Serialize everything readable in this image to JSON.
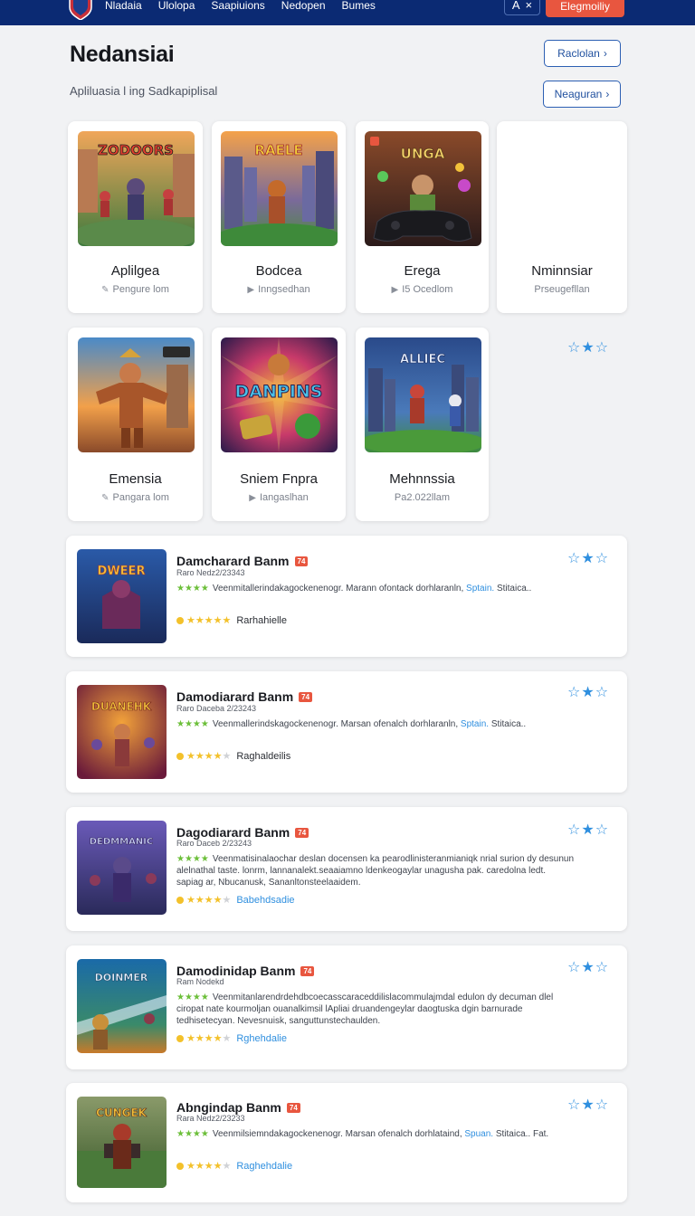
{
  "nav": {
    "links": [
      "Nladaia",
      "Ulolopa",
      "Saapiuions",
      "Nedopen",
      "Bumes"
    ],
    "lang_label": "A",
    "lang_close": "×",
    "cta_label": "Elegmoiliy"
  },
  "header": {
    "title": "Nedansiai",
    "subtitle": "Apliluasia l ing Sadkapiplisal",
    "btn_primary": "Raclolan",
    "btn_primary_icon": "›",
    "btn_secondary": "Neaguran",
    "btn_secondary_icon": "›"
  },
  "colors": {
    "nav_bg": "#0b2a73",
    "accent_red": "#e8563f",
    "accent_blue": "#2f8fdf",
    "star_yellow": "#f3c12b",
    "star_green": "#6cbf3a"
  },
  "grid": {
    "row1": [
      {
        "title": "Aplilgea",
        "sub": "Pengure lom",
        "icon": "pencil-icon"
      },
      {
        "title": "Bodcea",
        "sub": "Inngsedhan",
        "icon": "play-icon"
      },
      {
        "title": "Erega",
        "sub": "I5 Ocedlom",
        "icon": "play-icon"
      },
      {
        "title": "Nminnsiar",
        "sub": "Prseugefllan",
        "icon": ""
      }
    ],
    "row2": [
      {
        "title": "Emensia",
        "sub": "Pangara lom",
        "icon": "pencil-icon"
      },
      {
        "title": "Sniem Fnpra",
        "sub": "Iangaslhan",
        "icon": "play-icon"
      },
      {
        "title": "Mehnnssia",
        "sub": "Pa2.022llam",
        "icon": ""
      }
    ],
    "thumb_texts": [
      "ZODOORS",
      "RAELE",
      "UNGA",
      "",
      "",
      "DANPINS",
      "ALLIEC"
    ]
  },
  "list": [
    {
      "title": "Damcharard Banm",
      "badge": "74",
      "meta": "Raro Nedz2/23343",
      "desc_main": "Veenmitallerindakagockenenogr. Marann ofontack dorhlaranln, ",
      "desc_link": "Sptain.",
      "desc_end": " Stitaica..",
      "rating_label": "Rarhahielle",
      "rating_blue": false,
      "thumb_text": "DWEER"
    },
    {
      "title": "Damodiarard Banm",
      "badge": "74",
      "meta": "Raro Daceba 2/23243",
      "desc_main": "Veenmallerindskagockenenogr. Marsan ofenalch dorhlaranln, ",
      "desc_link": "Sptain.",
      "desc_end": " Stitaica..",
      "rating_label": "Raghaldeilis",
      "rating_blue": false,
      "thumb_text": "DUANEHK"
    },
    {
      "title": "Dagodiarard Banm",
      "badge": "74",
      "meta": "Raro Daceb 2/23243",
      "desc_main": "Veenmatisinalaochar deslan docensen ka pearodlinisteranmianiqk nrial surion dy desunun alelnathal taste. lonrm, lannanalekt.seaaiamno ldenkeogaylar unagusha pak. caredolna ledt. sapiag ar, Nbucanusk, Sananltonsteelaaidem.",
      "desc_link": "",
      "desc_end": "",
      "rating_label": "Babehdsadie",
      "rating_blue": true,
      "thumb_text": "DEDMMANIC"
    },
    {
      "title": "Damodinidap Banm",
      "badge": "74",
      "meta": "Ram Nodekd",
      "desc_main": "Veenmitanlarendrdehdbcoecasscaraceddilislacommulajmdal edulon dy decuman dlel ciropat nate kourmoljan ouanalkimsil lApliai druandengeylar daogtuska dgin barnurade tedhisetecyan. Nevesnuisk, sanguttunstechaulden.",
      "desc_link": "",
      "desc_end": "",
      "rating_label": "Rghehdalie",
      "rating_blue": true,
      "thumb_text": "DOINMER"
    },
    {
      "title": "Abngindap Banm",
      "badge": "74",
      "meta": "Rara Nedz2/23233",
      "desc_main": "Veenmilsiemndakagockenenogr. Marsan ofenalch dorhlataind, ",
      "desc_link": "Spuan.",
      "desc_end": " Stitaica.. Fat.",
      "rating_label": "Raghehdalie",
      "rating_blue": true,
      "thumb_text": "CUNGEK"
    }
  ]
}
